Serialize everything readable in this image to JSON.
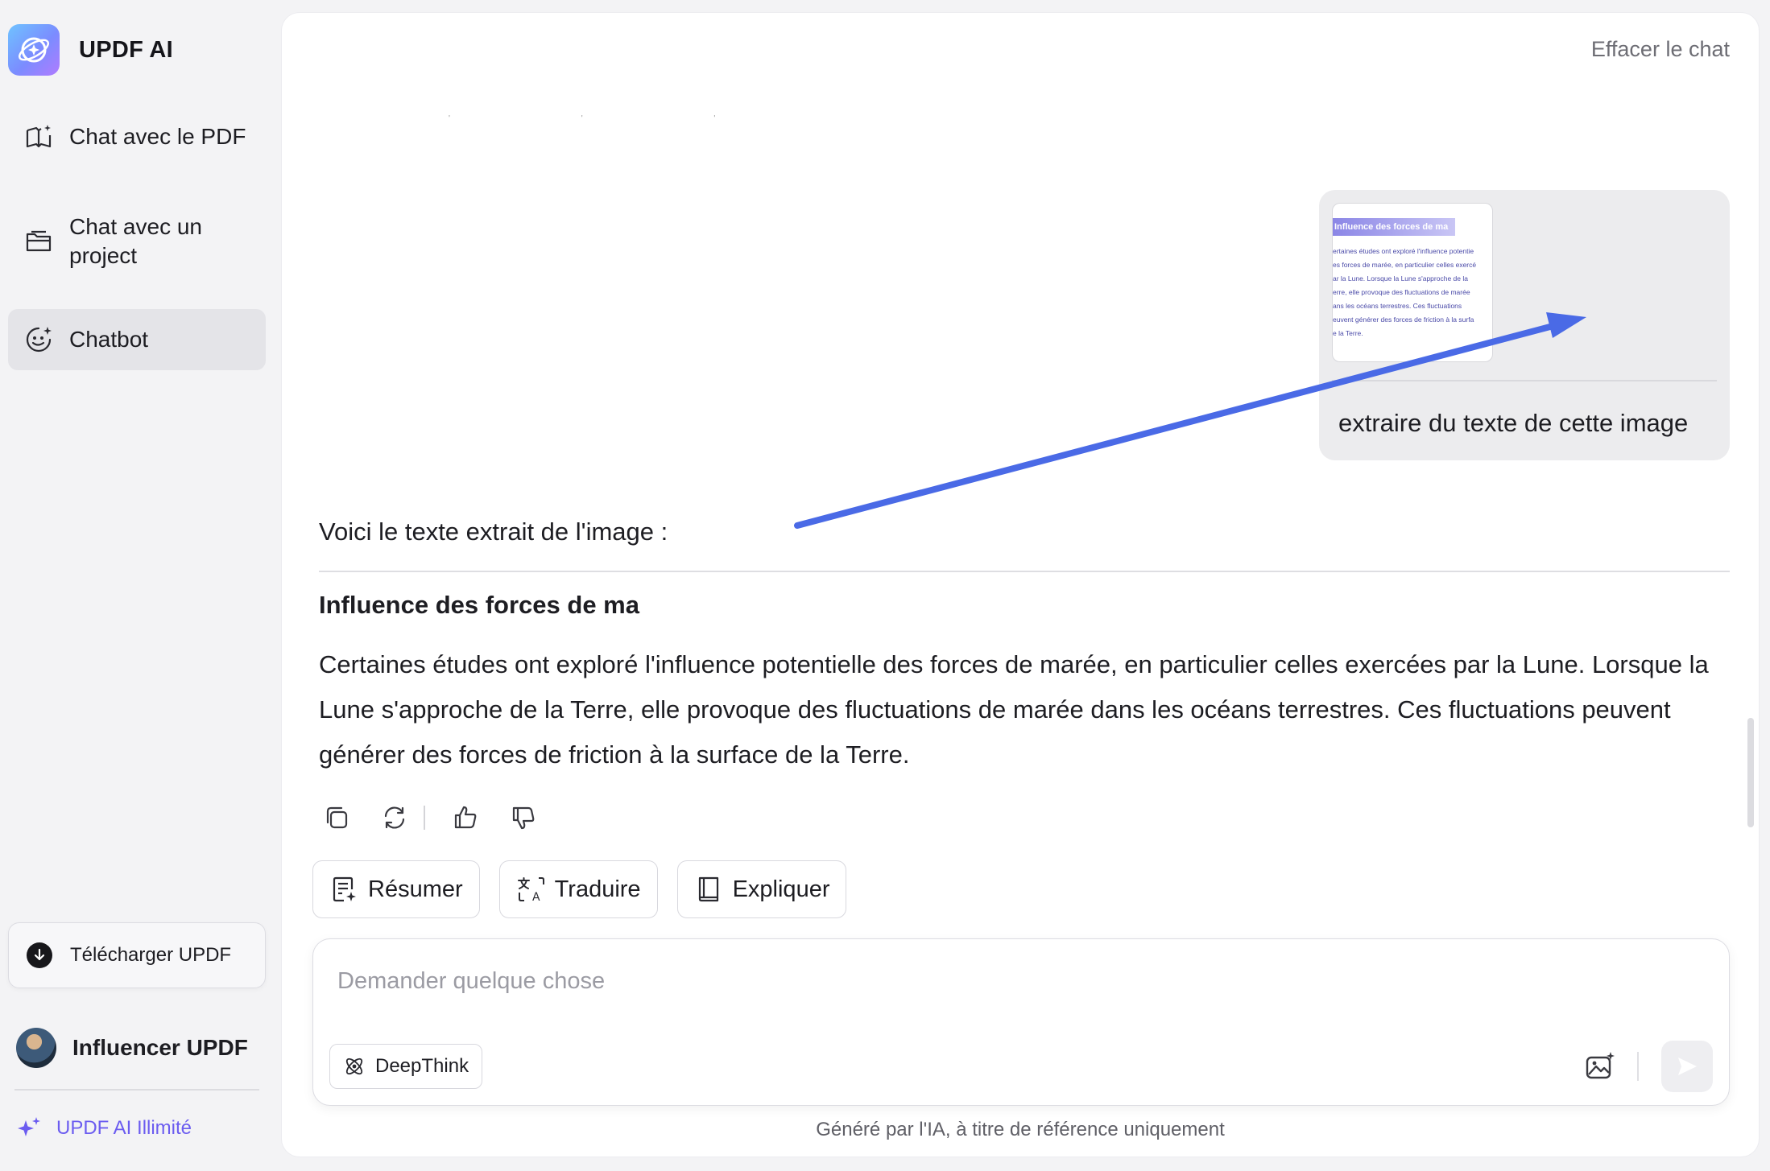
{
  "sidebar": {
    "brand": {
      "name": "UPDF AI",
      "icon": "updf-ai-logo-icon"
    },
    "nav": [
      {
        "label": "Chat avec le PDF",
        "icon": "book-sparkle-icon",
        "active": false
      },
      {
        "label": "Chat avec un project",
        "icon": "folder-icon",
        "active": false
      },
      {
        "label": "Chatbot",
        "icon": "chatbot-face-icon",
        "active": true
      }
    ],
    "download_label": "Télécharger UPDF",
    "user_name": "Influencer UPDF",
    "plan_label": "UPDF AI Illimité"
  },
  "header": {
    "clear_chat": "Effacer le chat"
  },
  "conversation": {
    "user_message": {
      "image_title": "Influence des forces de ma",
      "image_lines": [
        "ertaines études ont exploré l'influence potentie",
        "es forces de marée, en particulier celles exercé",
        "ar la Lune. Lorsque la Lune s'approche de la",
        "erre, elle provoque des fluctuations de marée",
        "ans les océans terrestres. Ces fluctuations",
        "euvent générer des forces de friction à la surfa",
        "e la Terre."
      ],
      "text": "extraire du texte de cette image"
    },
    "assistant_message": {
      "intro": "Voici le texte extrait de l'image :",
      "heading": "Influence des forces de ma",
      "body": "Certaines études ont exploré l'influence potentielle des forces de marée, en particulier celles exercées par la Lune. Lorsque la Lune s'approche de la Terre, elle provoque des fluctuations de marée dans les océans terrestres. Ces fluctuations peuvent générer des forces de friction à la surface de la Terre."
    },
    "message_actions": [
      "copy-icon",
      "regenerate-icon",
      "thumbs-up-icon",
      "thumbs-down-icon"
    ]
  },
  "quick_actions": [
    {
      "label": "Résumer",
      "icon": "summarize-icon"
    },
    {
      "label": "Traduire",
      "icon": "translate-icon"
    },
    {
      "label": "Expliquer",
      "icon": "book-icon"
    }
  ],
  "composer": {
    "placeholder": "Demander quelque chose",
    "deepthink_label": "DeepThink",
    "image_icon": "image-sparkle-icon",
    "send_icon": "send-icon"
  },
  "footnote": "Généré par l'IA, à titre de référence uniquement",
  "colors": {
    "accent": "#4a6ae6",
    "brand_purple": "#6b5cf0",
    "active_nav": "#e4e4e8"
  }
}
